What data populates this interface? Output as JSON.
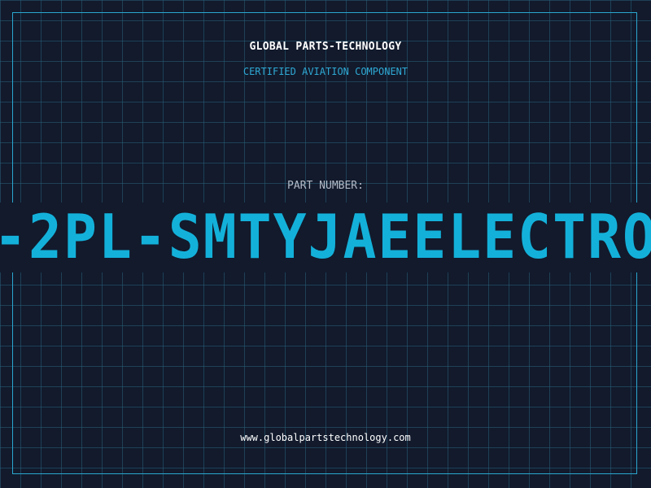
{
  "header": {
    "company": "GLOBAL PARTS-TECHNOLOGY",
    "subtitle": "CERTIFIED AVIATION COMPONENT"
  },
  "part": {
    "label": "PART NUMBER:",
    "number": "-2PL-SMTYJAEELECTRO"
  },
  "footer": {
    "url": "www.globalpartstechnology.com"
  },
  "colors": {
    "background": "#121a2c",
    "grid": "#285f78",
    "accent": "#13b1da",
    "frame": "#2aa7cf"
  }
}
